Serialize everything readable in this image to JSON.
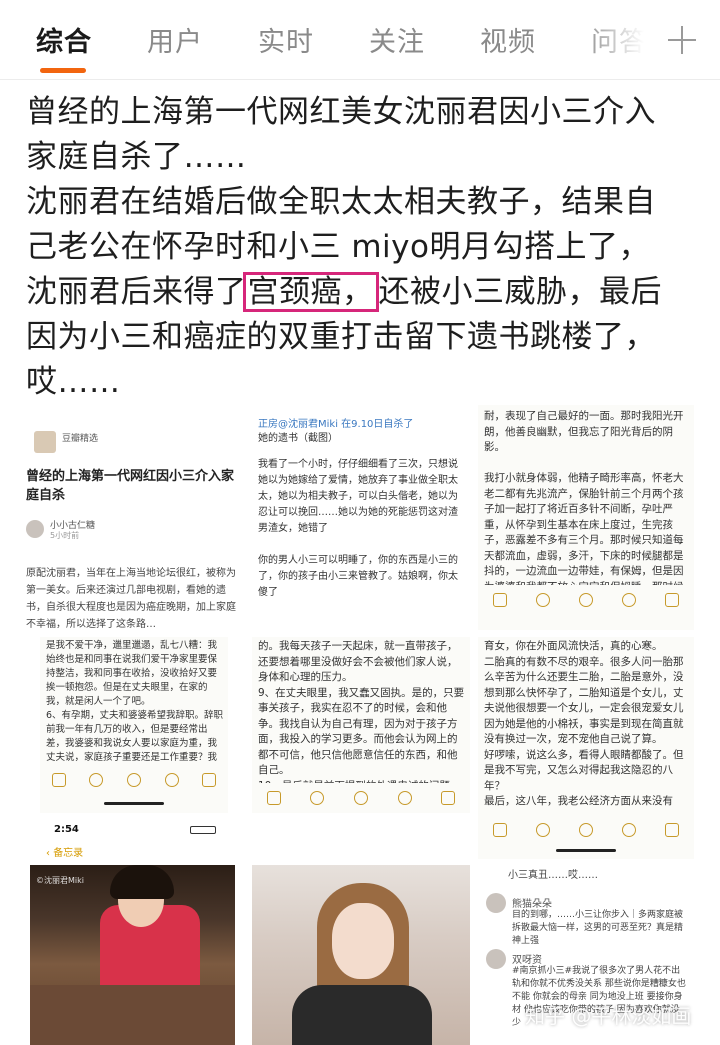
{
  "tabs": [
    {
      "label": "综合",
      "active": true
    },
    {
      "label": "用户",
      "active": false
    },
    {
      "label": "实时",
      "active": false
    },
    {
      "label": "关注",
      "active": false
    },
    {
      "label": "视频",
      "active": false
    },
    {
      "label": "问答",
      "active": false
    }
  ],
  "post": {
    "line1": "曾经的上海第一代网红美女沈丽君因小三介入",
    "line2": "家庭自杀了……",
    "line3": "沈丽君在结婚后做全职太太相夫教子，结果自",
    "line4": "己老公在怀孕时和小三 miyo明月勾搭上了，",
    "line5_pre": "沈丽君后来得了",
    "line5_highlight": "宫颈癌，",
    "line5_post": "还被小三威胁，最后",
    "line6": "因为小三和癌症的双重打击留下遗书跳楼了，",
    "line7": "哎……"
  },
  "article_card": {
    "source": "豆瓣精选",
    "title": "曾经的上海第一代网红因小三介入家庭自杀",
    "author": "小小古仁糖",
    "time": "5小时前",
    "body": "原配沈丽君，当年在上海当地论坛很红，被称为第一美女。后来还演过几部电视剧，看她的遗书，自杀很大程度也是因为癌症晚期，加上家庭不幸福，所以选择了这条路…"
  },
  "weibo_card": {
    "header": "正房@沈丽君Miki 在9.10日自杀了",
    "subheader": "她的遗书（截图）",
    "body": "我看了一个小时，仔仔细细看了三次，只想说她以为她嫁给了爱情，她放弃了事业做全职太太，她以为相夫教子，可以白头偕老，她以为忍让可以挽回……她以为她的死能惩罚这对渣男渣女，她错了\n\n你的男人小三可以明睡了，你的东西是小三的了，你的孩子由小三来管教了。姑娘啊，你太傻了"
  },
  "note_top_right": "耐，表现了自己最好的一面。那时我阳光开朗，他善良幽默，但我忘了阳光背后的阴影。\n\n我打小就身体弱，他精子畸形率高，怀老大老二都有先兆流产，保胎针前三个月两个孩子加一起打了将近百多针不间断，孕吐严重，从怀孕到生基本在床上度过，生完孩子，恶露差不多有三个月。那时候只知道每天都流血，虚弱，多汗，下床的时候腿都是抖的，一边流血一边带娃，有保姆，但是因为婆婆和我都不放心宝宝和保姆睡，那时候有新闻保姆喂安眠药给孩子",
  "note_mid_left": "是我不爱干净，邋里邋遢，乱七八糟：我始终也是和同事在说我们爱干净家里要保持整洁，我和同事在收拾，没收拾好又要挨一顿抱怨。但是在丈夫眼里，在家的我，就是闲人一个了吧。\n6、有孕期，丈夫和婆婆希望我辞职。辞职前我一年有几万的收入，但是要经常出差，我婆婆和我说女人要以家庭为重，我丈夫说，家庭孩子重要还是工作重要？我以前赚的多，花的也多，现在在家要",
  "note_mid_center": "的。我每天孩子一天起床，就一直带孩子，还要想着哪里没做好会不会被他们家人说，身体和心理的压力。\n9、在丈夫眼里，我又蠢又固执。是的，只要事关孩子，我实在忍不了的时候，会和他争。我找自认为自己有理，因为对于孩子方面，我投入的学习更多。而他会认为网上的都不可信，他只信他愿意信任的东西，和他自己。\n10、最后就是前面提到的外遇忠诚的问题，我第一个孩子在我肚子里约五个月的时候，他的同学告诉我他包养了一个小",
  "note_mid_right": "育女，你在外面风流快活，真的心寒。\n二胎真的有数不尽的艰辛。很多人问一胎那么辛苦为什么还要生二胎，二胎是意外，没想到那么快怀孕了，二胎知道是个女儿，丈夫说他很想要一个女儿，一定会很宠爱女儿因为她是他的小棉袄，事实是到现在简直就没有换过一次，宠不宠他自己说了算。\n好啰嗦，说这么多，看得人眼睛都酸了。但是我不写完，又怎么对得起我这隐忍的八年？\n最后，这八年，我老公经济方面从来没有",
  "phone_status": {
    "time": "2:54",
    "back_label": "备忘录"
  },
  "photo1_caption": "©沈丽君Miki",
  "comments": {
    "top": "小三真丑……哎……",
    "c1_name": "熊猫朵朵",
    "c1_text": "目的到哪，……小三让你步入｜多两家庭被拆散最大恼一样，这男的可恶至死？真是精神上强",
    "c2_name": "双呀资",
    "c2_text": "#南京抓小三#我说了很多次了男人花不出轨和你就不优秀没关系 那些说你是糟糠女也不能 你就会的母亲 同为地没上班 要接你身材 他也应该吃你带的孩子 因为喜欢你就没少"
  },
  "watermark": "知乎 @平林淡如画"
}
